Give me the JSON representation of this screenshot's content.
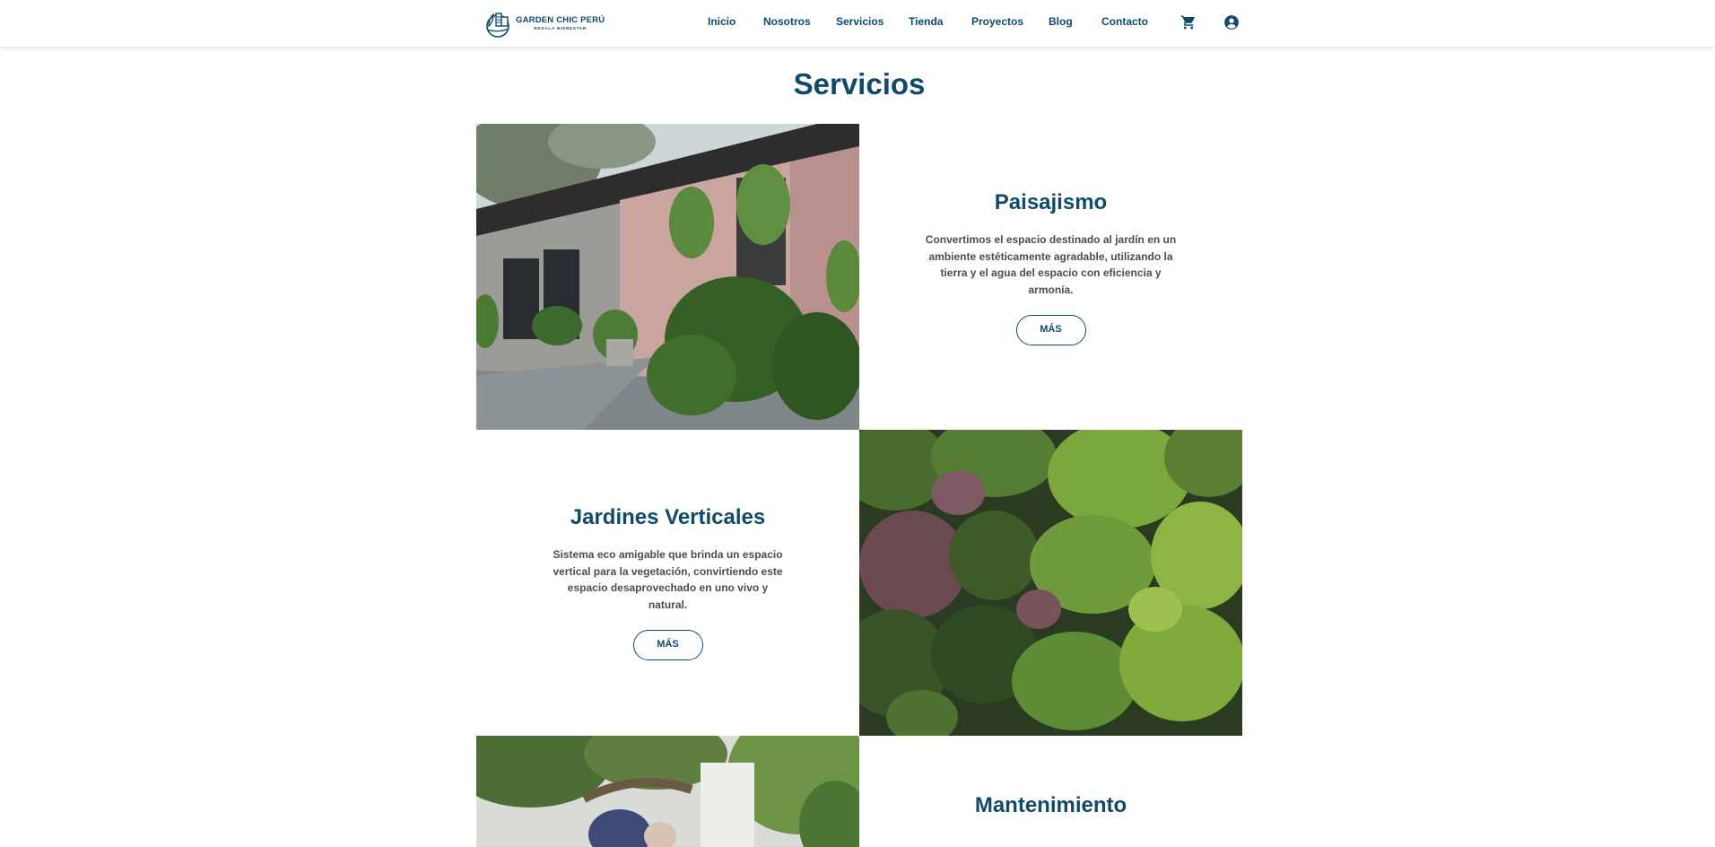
{
  "brand": {
    "name": "GARDEN CHIC PERÚ",
    "tagline": "REGALA BIENESTAR"
  },
  "nav": {
    "items": [
      {
        "label": "Inicio"
      },
      {
        "label": "Nosotros"
      },
      {
        "label": "Servicios"
      },
      {
        "label": "Tienda"
      },
      {
        "label": "Proyectos"
      },
      {
        "label": "Blog"
      },
      {
        "label": "Contacto"
      }
    ],
    "icons": {
      "cart": "shopping-cart-icon",
      "account": "user-account-icon"
    }
  },
  "page": {
    "title": "Servicios"
  },
  "services": [
    {
      "title": "Paisajismo",
      "description": "Convertimos el espacio destinado al jardín en un ambiente estéticamente agradable, utilizando la tierra y el agua del espacio con eficiencia y armonía.",
      "button": "MÁS"
    },
    {
      "title": "Jardines Verticales",
      "description": "Sistema eco amigable que brinda un espacio vertical para la vegetación, convirtiendo este espacio desaprovechado en uno vivo y natural.",
      "button": "MÁS"
    },
    {
      "title": "Mantenimiento"
    }
  ],
  "colors": {
    "primary": "#0f4a6b",
    "text": "#4d4d4d",
    "background": "#ffffff"
  }
}
